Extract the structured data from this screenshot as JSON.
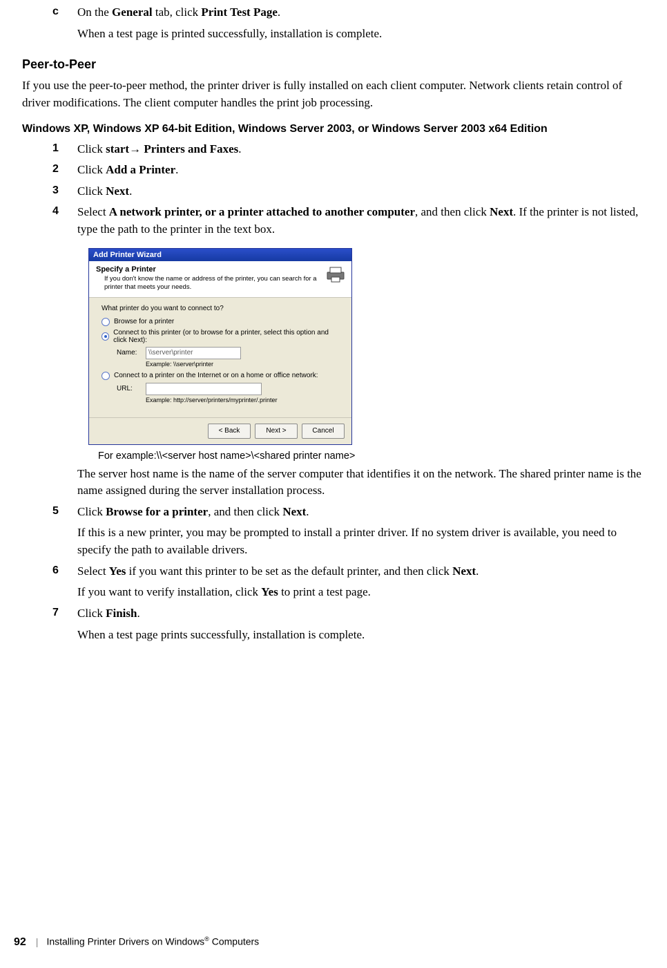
{
  "intro": {
    "mark": "c",
    "text_pre": "On the ",
    "bold1": "General",
    "text_mid": " tab, click ",
    "bold2": "Print Test Page",
    "text_post": ".",
    "after": "When a test page is printed successfully, installation is complete."
  },
  "peer_heading": "Peer-to-Peer",
  "peer_para": "If you use the peer-to-peer method, the printer driver is fully installed on each client computer. Network clients retain control of driver modifications. The client computer handles the print job processing.",
  "os_heading": "Windows XP, Windows XP 64-bit Edition, Windows Server 2003, or Windows Server 2003 x64 Edition",
  "steps": {
    "s1": {
      "mark": "1",
      "pre": "Click ",
      "b1": "start",
      "arrow": "→ ",
      "b2": "Printers and Faxes",
      "post": "."
    },
    "s2": {
      "mark": "2",
      "pre": "Click ",
      "b1": "Add a Printer",
      "post": "."
    },
    "s3": {
      "mark": "3",
      "pre": "Click ",
      "b1": "Next",
      "post": "."
    },
    "s4": {
      "mark": "4",
      "pre": "Select ",
      "b1": "A network printer, or a printer attached to another computer",
      "mid": ", and then click ",
      "b2": "Next",
      "post": ". If the printer is not listed, type the path to the printer in the text box."
    },
    "s4_after": "The server host name is the name of the server computer that identifies it on the network. The shared printer name is the name assigned during the server installation process.",
    "s5": {
      "mark": "5",
      "pre": "Click ",
      "b1": "Browse for a printer",
      "mid": ", and then click ",
      "b2": "Next",
      "post": ".",
      "after": "If this is a new printer, you may be prompted to install a printer driver. If no system driver is available, you need to specify the path to available drivers."
    },
    "s6": {
      "mark": "6",
      "pre": "Select ",
      "b1": "Yes",
      "mid": " if you want this printer to be set as the default printer, and then click ",
      "b2": "Next",
      "post": ".",
      "after_pre": "If you want to verify installation, click ",
      "after_b": "Yes",
      "after_post": " to print a test page."
    },
    "s7": {
      "mark": "7",
      "pre": "Click ",
      "b1": "Finish",
      "post": ".",
      "after": "When a test page prints successfully, installation is complete."
    }
  },
  "wizard": {
    "title": "Add Printer Wizard",
    "head_title": "Specify a Printer",
    "head_sub": "If you don't know the name or address of the printer, you can search for a printer that meets your needs.",
    "question": "What printer do you want to connect to?",
    "opt_browse": "Browse for a printer",
    "opt_connect": "Connect to this printer (or to browse for a printer, select this option and click Next):",
    "name_label": "Name:",
    "name_value": "\\\\server\\printer",
    "name_example": "Example: \\\\server\\printer",
    "opt_url": "Connect to a printer on the Internet or on a home or office network:",
    "url_label": "URL:",
    "url_example": "Example: http://server/printers/myprinter/.printer",
    "btn_back": "< Back",
    "btn_next": "Next >",
    "btn_cancel": "Cancel"
  },
  "example_caption": "For example:\\\\<server host name>\\<shared printer name>",
  "footer": {
    "page": "92",
    "sep": "|",
    "title_pre": "Installing Printer Drivers on Windows",
    "reg": "®",
    "title_post": " Computers"
  }
}
